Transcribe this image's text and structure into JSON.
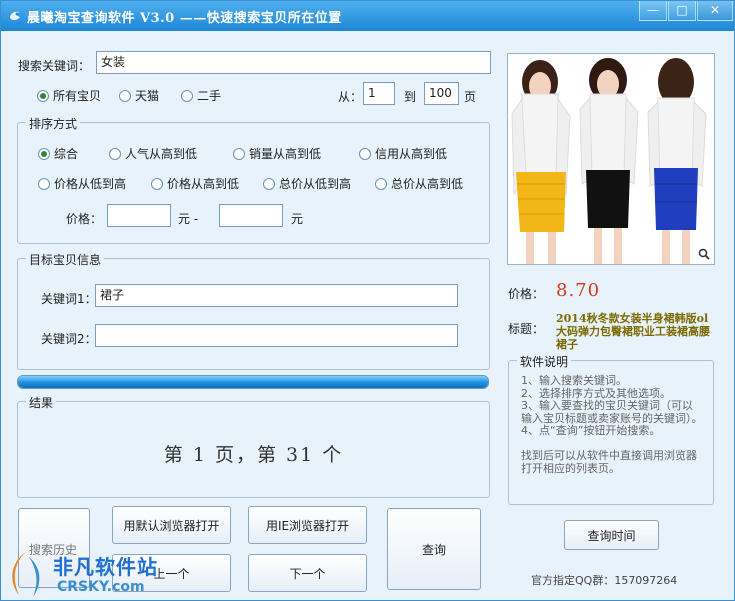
{
  "window": {
    "title": "晨曦淘宝查询软件 V3.0  ——快速搜索宝贝所在位置",
    "min_label": "—",
    "max_label": "□",
    "close_label": "✕"
  },
  "search": {
    "label": "搜索关键词：",
    "value": "女装",
    "scope_options": [
      "所有宝贝",
      "天猫",
      "二手"
    ],
    "scope_selected": "所有宝贝",
    "from_label": "从：",
    "from_value": "1",
    "to_label": "到",
    "to_value": "100",
    "page_unit": "页"
  },
  "sort": {
    "group_label": "排序方式",
    "options_row1": [
      "综合",
      "人气从高到低",
      "销量从高到低",
      "信用从高到低"
    ],
    "options_row2": [
      "价格从低到高",
      "价格从高到低",
      "总价从低到高",
      "总价从高到低"
    ],
    "selected": "综合",
    "price_label": "价格：",
    "price_min": "",
    "price_unit1": "元 -",
    "price_max": "",
    "price_unit2": "元"
  },
  "target": {
    "group_label": "目标宝贝信息",
    "kw1_label": "关键词1：",
    "kw1_value": "裙子",
    "kw2_label": "关键词2：",
    "kw2_value": ""
  },
  "progress": {
    "value": 1.0
  },
  "result": {
    "group_label": "结果",
    "text": "第 1 页，第 31 个"
  },
  "buttons": {
    "history": "搜索历史",
    "open_default": "用默认浏览器打开",
    "open_ie": "用IE浏览器打开",
    "prev": "上一个",
    "next": "下一个",
    "query": "查询",
    "query_time": "查询时间"
  },
  "product": {
    "price_label": "价格：",
    "price": "8.70",
    "title_label": "标题：",
    "title": "2014秋冬款女装半身裙韩版ol大码弹力包臀裙职业工装裙高腰裙子",
    "zoom_icon": "magnifier-icon"
  },
  "help": {
    "group_label": "软件说明",
    "text": "1、输入搜索关键词。\n2、选择排序方式及其他选项。\n3、输入要查找的宝贝关键词（可以输入宝贝标题或卖家账号的关键词）。\n4、点“查询”按钮开始搜索。\n\n找到后可以从软件中直接调用浏览器打开相应的列表页。",
    "qq": "官方指定QQ群：157097264"
  },
  "watermark": {
    "main": "非凡软件站",
    "sub": "CRSKY.com"
  },
  "colors": {
    "titlebar": "#1e86d6",
    "background": "#e7f2fb",
    "price": "#d63a1e",
    "product_title": "#7b6a00",
    "skirt_colors": [
      "#f2b616",
      "#111111",
      "#1f3fc0"
    ]
  }
}
